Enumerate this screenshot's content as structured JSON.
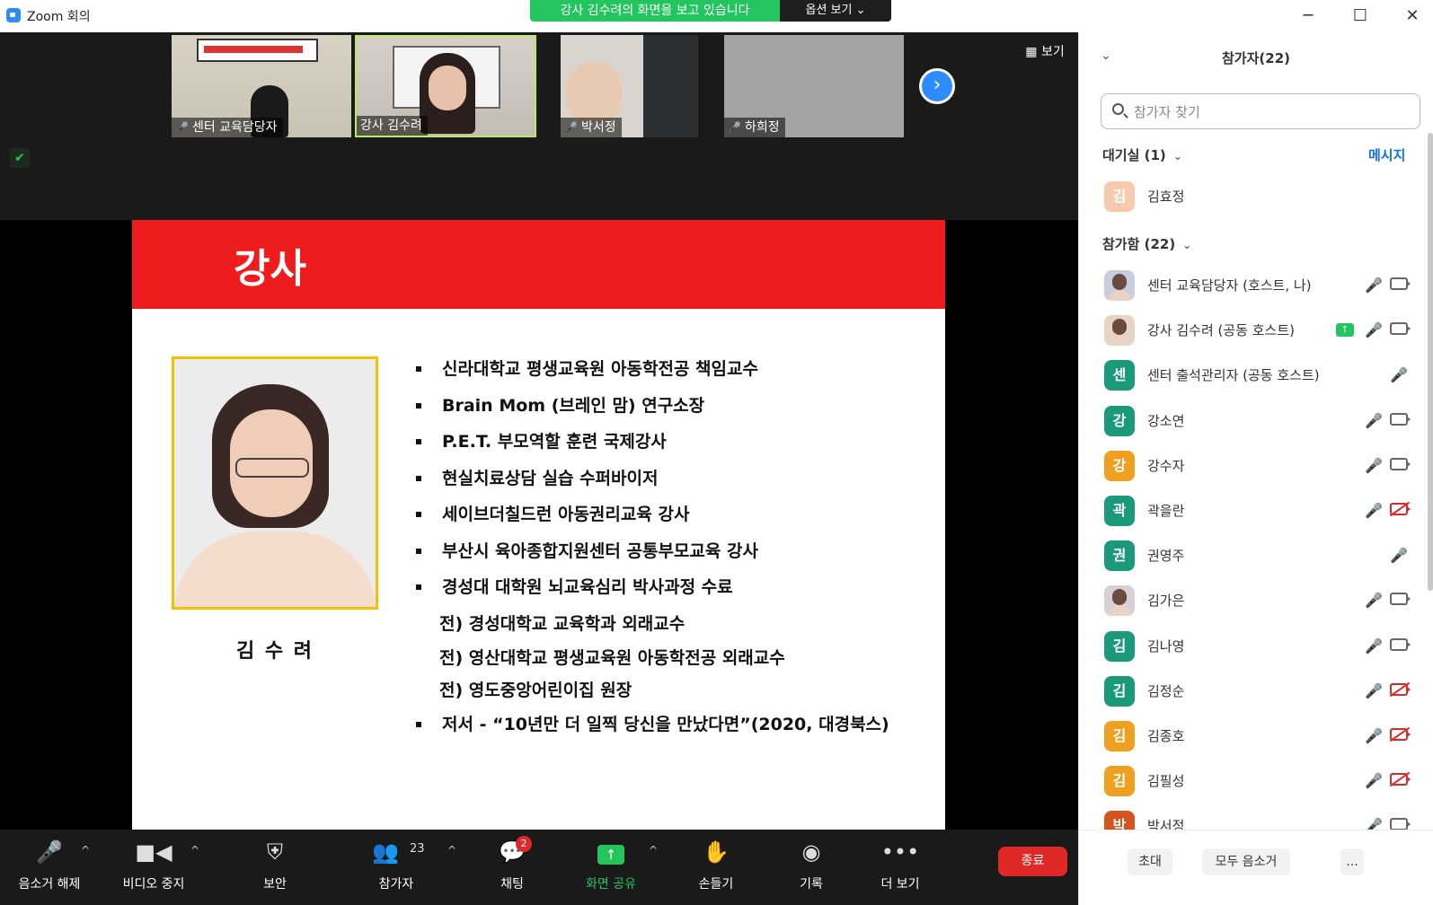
{
  "window": {
    "title": "Zoom 회의",
    "minimize": "─",
    "maximize": "☐",
    "close": "✕"
  },
  "share_banner": {
    "text": "강사 김수려의 화면을 보고 있습니다",
    "options_label": "옵션 보기 ⌄"
  },
  "thumbnails": [
    {
      "name": "센터 교육담당자",
      "muted": true
    },
    {
      "name": "강사 김수려",
      "muted": false,
      "active_speaker": true
    },
    {
      "name": "박서정",
      "muted": true
    },
    {
      "name": "하희정",
      "muted": true
    }
  ],
  "gallery": {
    "view_label": "보기",
    "next_icon": "chevron-right-icon"
  },
  "slide": {
    "title": "강사",
    "photo_caption": "김 수 려",
    "bullets": [
      {
        "text": "신라대학교 평생교육원 아동학전공 책임교수",
        "sub": false
      },
      {
        "text": "Brain Mom (브레인 맘) 연구소장",
        "sub": false
      },
      {
        "text": "P.E.T. 부모역할 훈련 국제강사",
        "sub": false
      },
      {
        "text": "현실치료상담 실습 수퍼바이저",
        "sub": false
      },
      {
        "text": "세이브더칠드런 아동권리교육 강사",
        "sub": false
      },
      {
        "text": "부산시 육아종합지원센터 공통부모교육  강사",
        "sub": false
      },
      {
        "text": "경성대 대학원 뇌교육심리 박사과정 수료",
        "sub": false
      },
      {
        "text": "전) 경성대학교 교육학과 외래교수",
        "sub": true
      },
      {
        "text": "전) 영산대학교  평생교육원 아동학전공 외래교수",
        "sub": true
      },
      {
        "text": "전) 영도중앙어린이집 원장",
        "sub": true
      },
      {
        "text": "저서 - “10년만 더 일찍 당신을 만났다면”(2020, 대경북스)",
        "sub": false
      }
    ]
  },
  "toolbar": {
    "unmute": "음소거 해제",
    "stop_video": "비디오 중지",
    "security": "보안",
    "participants": "참가자",
    "participants_count": "23",
    "chat": "채팅",
    "chat_badge": "2",
    "share_screen": "화면 공유",
    "raise_hand": "손들기",
    "record": "기록",
    "more": "더 보기",
    "end": "종료"
  },
  "panel": {
    "title": "참가자(22)",
    "search_placeholder": "참가자 찾기",
    "waiting_room_label": "대기실 (1)",
    "message_link": "메시지",
    "waiting": [
      {
        "name": "김효정",
        "initial": "김",
        "color": "#f7c9ad"
      }
    ],
    "joined_label": "참가함 (22)",
    "participants": [
      {
        "name": "센터 교육담당자 (호스트, 나)",
        "initial": "",
        "color": "#c7cde0",
        "photo": true,
        "mic": "off",
        "cam": "on"
      },
      {
        "name": "강사 김수려 (공동 호스트)",
        "initial": "",
        "color": "#e8d4c6",
        "photo": true,
        "mic": "on",
        "cam": "on",
        "sharing": true
      },
      {
        "name": "센터 출석관리자 (공동 호스트)",
        "initial": "센",
        "color": "#1a9a7a",
        "mic": "off",
        "cam": "none"
      },
      {
        "name": "강소연",
        "initial": "강",
        "color": "#1a9a7a",
        "mic": "off",
        "cam": "on"
      },
      {
        "name": "강수자",
        "initial": "강",
        "color": "#f0a020",
        "mic": "off",
        "cam": "on"
      },
      {
        "name": "곽을란",
        "initial": "곽",
        "color": "#1a9a7a",
        "mic": "off",
        "cam": "off"
      },
      {
        "name": "권영주",
        "initial": "권",
        "color": "#1a9a7a",
        "mic": "off",
        "cam": "none"
      },
      {
        "name": "김가은",
        "initial": "",
        "color": "#d8d0d8",
        "photo": true,
        "mic": "off",
        "cam": "on"
      },
      {
        "name": "김나영",
        "initial": "김",
        "color": "#1a9a7a",
        "mic": "off",
        "cam": "on"
      },
      {
        "name": "김정순",
        "initial": "김",
        "color": "#1a9a7a",
        "mic": "off",
        "cam": "off"
      },
      {
        "name": "김종호",
        "initial": "김",
        "color": "#f0a020",
        "mic": "off",
        "cam": "off"
      },
      {
        "name": "김필성",
        "initial": "김",
        "color": "#f0a020",
        "mic": "off",
        "cam": "off"
      },
      {
        "name": "박서정",
        "initial": "박",
        "color": "#d9531e",
        "mic": "off",
        "cam": "on"
      }
    ],
    "footer": {
      "invite": "초대",
      "mute_all": "모두 음소거",
      "more": "..."
    }
  }
}
